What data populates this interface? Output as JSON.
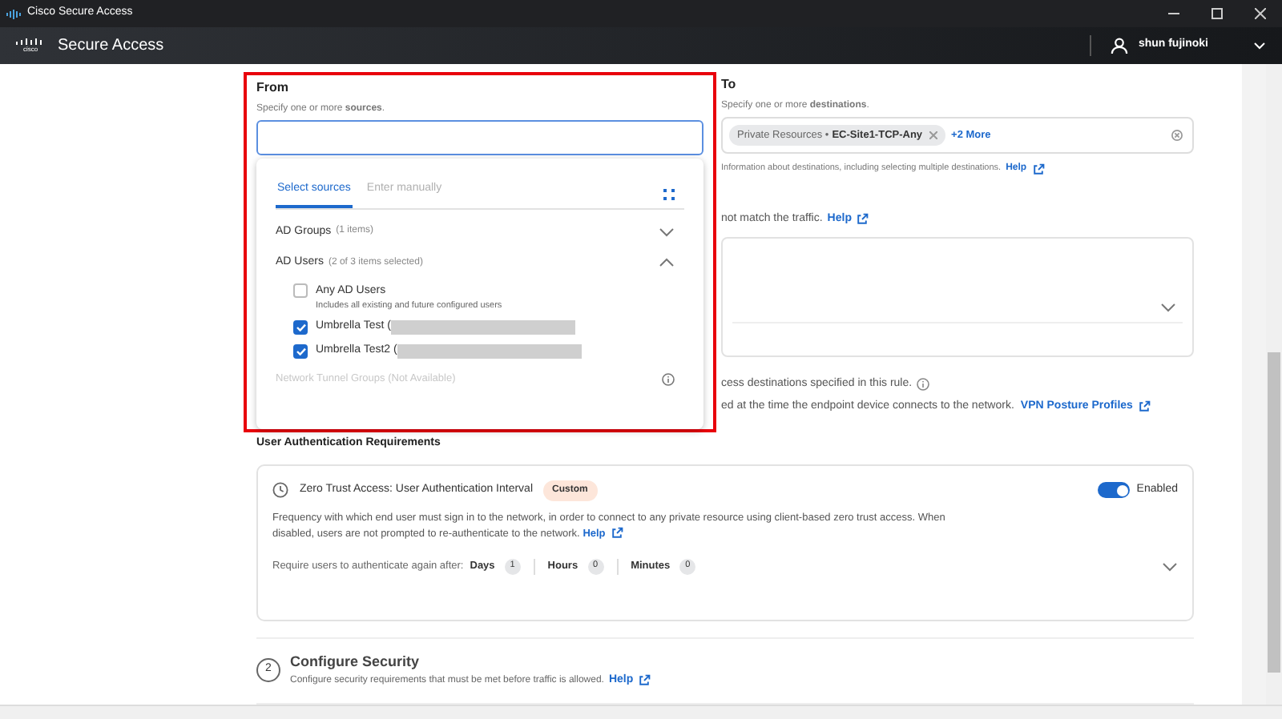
{
  "window": {
    "title": "Cisco Secure Access"
  },
  "header": {
    "logo_text": "cisco",
    "app_name": "Secure Access",
    "user": "shun fujinoki"
  },
  "from": {
    "label": "From",
    "hint": "Specify one or more **sources**.",
    "popup": {
      "tabs": [
        {
          "label": "Select sources",
          "selected": true
        },
        {
          "label": "Enter manually",
          "selected": false
        }
      ],
      "groups": [
        {
          "name": "AD Groups",
          "count": "(1 items)",
          "expanded": false
        },
        {
          "name": "AD Users",
          "count": "(2 of 3 items selected)",
          "expanded": true
        }
      ],
      "options": [
        {
          "label": "Any AD Users",
          "note": "Includes all existing and future configured users",
          "checked": false
        },
        {
          "label": "Umbrella Test (",
          "checked": true
        },
        {
          "label": "Umbrella Test2 (",
          "checked": true
        }
      ],
      "unavailable": "Network Tunnel Groups (Not Available)"
    }
  },
  "to": {
    "label": "To",
    "hint": "Specify one or more **destinations**.",
    "chip": {
      "category": "Private Resources",
      "separator": "•",
      "name": "EC-Site1-TCP-Any"
    },
    "more": "+2 More",
    "info": "Information about destinations, including selecting multiple destinations.",
    "help": "Help"
  },
  "fragments": [
    {
      "text": "not match the traffic.",
      "link": "Help"
    },
    {
      "text": "cess destinations specified in this rule."
    },
    {
      "text": "ed at the time the endpoint device connects to the network.",
      "link": "VPN Posture Profiles"
    }
  ],
  "auth": {
    "heading": "User Authentication Requirements",
    "title": "Zero Trust Access: User Authentication Interval",
    "badge": "Custom",
    "enabled": true,
    "toggle_label": "Enabled",
    "description": "Frequency with which end user must sign in to the network, in order to connect to any private resource using client-based zero trust access. When disabled, users are not prompted to re-authenticate to the network.",
    "help": "Help",
    "require_label": "Require users to authenticate again after:",
    "units": [
      {
        "name": "Days",
        "value": "1"
      },
      {
        "name": "Hours",
        "value": "0"
      },
      {
        "name": "Minutes",
        "value": "0"
      }
    ]
  },
  "step": {
    "number": "2",
    "title": "Configure Security",
    "description": "Configure security requirements that must be met before traffic is allowed.",
    "help": "Help"
  }
}
